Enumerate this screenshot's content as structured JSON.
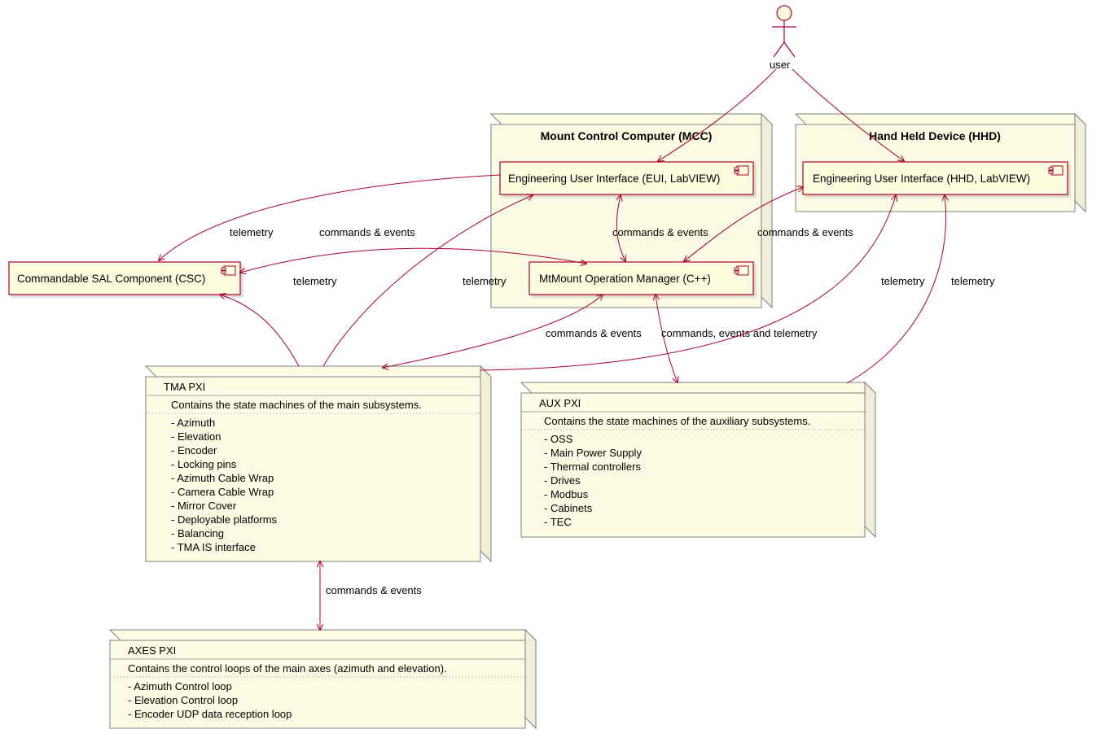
{
  "actor": {
    "label": "user"
  },
  "nodes": {
    "mcc": {
      "title": "Mount Control Computer (MCC)"
    },
    "hhd": {
      "title": "Hand Held Device (HHD)"
    }
  },
  "components": {
    "eui": {
      "label": "Engineering User Interface (EUI, LabVIEW)"
    },
    "hhd_eui": {
      "label": "Engineering User Interface (HHD, LabVIEW)"
    },
    "opman": {
      "label": "MtMount Operation Manager (C++)"
    },
    "csc": {
      "label": "Commandable SAL Component (CSC)"
    }
  },
  "objects": {
    "tma": {
      "title": "TMA PXI",
      "subtitle": "Contains the state machines of the main subsystems.",
      "items": [
        "- Azimuth",
        "- Elevation",
        "- Encoder",
        "- Locking pins",
        "- Azimuth Cable Wrap",
        "- Camera Cable Wrap",
        "- Mirror Cover",
        "- Deployable platforms",
        "- Balancing",
        "- TMA IS interface"
      ]
    },
    "aux": {
      "title": "AUX PXI",
      "subtitle": "Contains the state machines of the auxiliary subsystems.",
      "items": [
        "- OSS",
        "- Main Power Supply",
        "- Thermal controllers",
        "- Drives",
        "- Modbus",
        "- Cabinets",
        "- TEC"
      ]
    },
    "axes": {
      "title": "AXES PXI",
      "subtitle": "Contains the control loops of the main axes (azimuth and elevation).",
      "items": [
        "- Azimuth Control loop",
        "- Elevation Control loop",
        "- Encoder UDP data reception loop"
      ]
    }
  },
  "edges": {
    "user_eui": "",
    "user_hhd": "",
    "csc_telemetry": "telemetry",
    "csc_cmd": "commands & events",
    "eui_opman": "commands & events",
    "hhd_opman_cmd": "commands & events",
    "opman_tma": "commands & events",
    "opman_aux": "commands, events and telemetry",
    "tma_eui_tel": "telemetry",
    "tma_hhd_tel": "telemetry",
    "tma_csc_tel": "telemetry",
    "aux_hhd_tel": "telemetry",
    "tma_axes": "commands & events"
  }
}
